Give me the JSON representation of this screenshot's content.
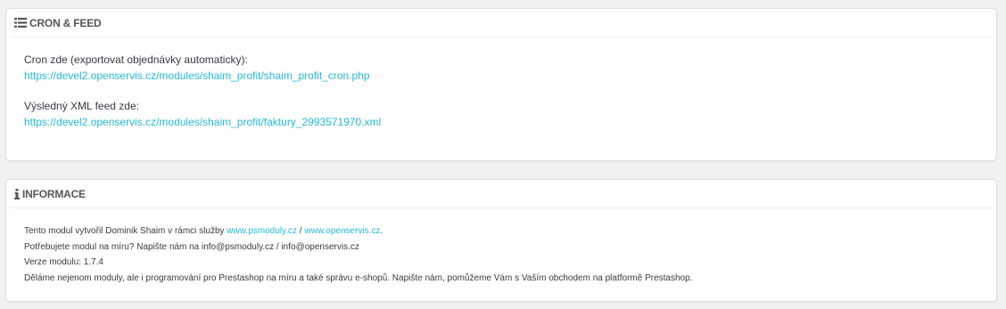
{
  "cron_panel": {
    "title": "CRON & FEED",
    "cron_label": "Cron zde (exportovat objednávky automaticky):",
    "cron_url": "https://devel2.openservis.cz/modules/shaim_profit/shaim_profit_cron.php",
    "feed_label": "Výsledný XML feed zde:",
    "feed_url": "https://devel2.openservis.cz/modules/shaim_profit/faktury_2993571970.xml"
  },
  "info_panel": {
    "title": "INFORMACE",
    "line1_prefix": "Tento modul vytvořil Dominik Shaim v rámci služby ",
    "line1_link1": "www.psmoduly.cz",
    "line1_sep": " / ",
    "line1_link2": "www.openservis.cz",
    "line1_suffix": ".",
    "line2": "Potřebujete modul na míru? Napište nám na info@psmoduly.cz / info@openservis.cz",
    "line3": "Verze modulu: 1.7.4",
    "line4": "Děláme nejenom moduly, ale i programování pro Prestashop na míru a také správu e-shopů. Napište nám, pomůžeme Vám s Vaším obchodem na platformě Prestashop."
  },
  "icons": {
    "cron_icon": "list-icon",
    "info_icon": "info-icon"
  },
  "colors": {
    "link": "#25b9d7",
    "background": "#eff1f2",
    "text": "#363a41"
  }
}
